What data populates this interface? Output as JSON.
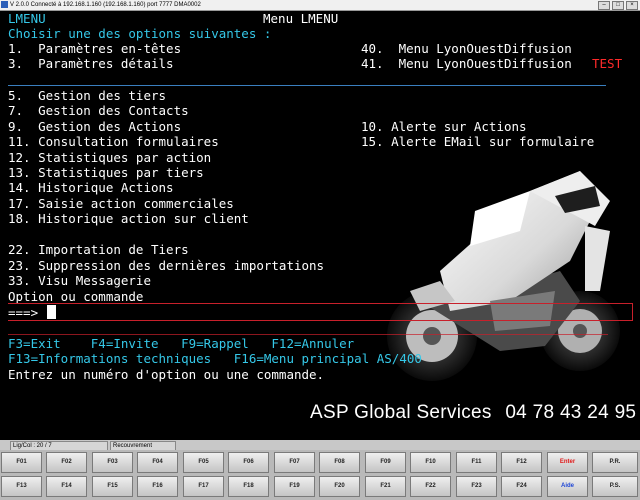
{
  "window": {
    "title": "V 2.0.0 Connecté à 192.168.1.160 (192.168.1.160) port 7777  DMA0002"
  },
  "screen": {
    "program": "LMENU",
    "header": "Menu LMENU",
    "prompt": "Choisir une des options suivantes :",
    "left_options": [
      "1.  Paramètres en-têtes",
      "3.  Paramètres détails",
      "5.  Gestion des tiers",
      "7.  Gestion des Contacts",
      "9.  Gestion des Actions",
      "11. Consultation formulaires",
      "12. Statistiques par action",
      "13. Statistiques par tiers",
      "14. Historique Actions",
      "17. Saisie action commerciales",
      "18. Historique action sur client",
      "22. Importation de Tiers",
      "23. Suppression des dernières importations",
      "33. Visu Messagerie"
    ],
    "right_options": [
      "40.  Menu LyonOuestDiffusion",
      "41.  Menu LyonOuestDiffusion",
      "10. Alerte sur Actions",
      "15. Alerte EMail sur formulaire"
    ],
    "test_tag": "TEST",
    "command_label": "Option ou commande",
    "command_arrow": "===>",
    "command_value": "",
    "fkeys_line1": "F3=Exit    F4=Invite   F9=Rappel   F12=Annuler",
    "fkeys_line2": "F13=Informations techniques   F16=Menu principal AS/400",
    "message": "Entrez un numéro d'option ou une commande."
  },
  "branding": {
    "text": "ASP Global Services",
    "phone": "04 78 43 24 95"
  },
  "statusbar": {
    "position": "Lig/Col : 20 / 7",
    "mode": "Recouvrement"
  },
  "function_keys": {
    "row1": [
      "F01",
      "F02",
      "F03",
      "F04",
      "F05",
      "F06",
      "F07",
      "F08",
      "F09",
      "F10",
      "F11",
      "F12",
      "Enter",
      "P.R."
    ],
    "row2": [
      "F13",
      "F14",
      "F15",
      "F16",
      "F17",
      "F18",
      "F19",
      "F20",
      "F21",
      "F22",
      "F23",
      "F24",
      "Aide",
      "P.S."
    ]
  },
  "colors": {
    "text": "#ffffff",
    "accent": "#35c8e8",
    "test": "#ff2a2a",
    "background": "#000000"
  }
}
